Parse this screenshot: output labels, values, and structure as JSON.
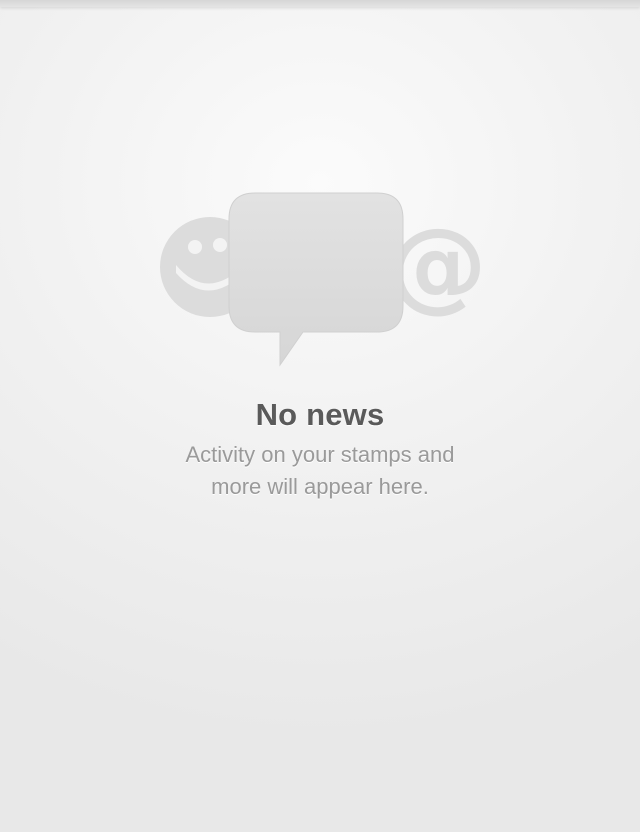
{
  "empty_state": {
    "title": "No news",
    "subtitle": "Activity on your stamps and more will appear here.",
    "icons": [
      "smiley-icon",
      "speech-bubble-icon",
      "at-sign-icon"
    ]
  },
  "colors": {
    "title": "#5a5a5a",
    "subtitle": "#9a9a9a",
    "icon_fill": "#d9d9d9"
  }
}
